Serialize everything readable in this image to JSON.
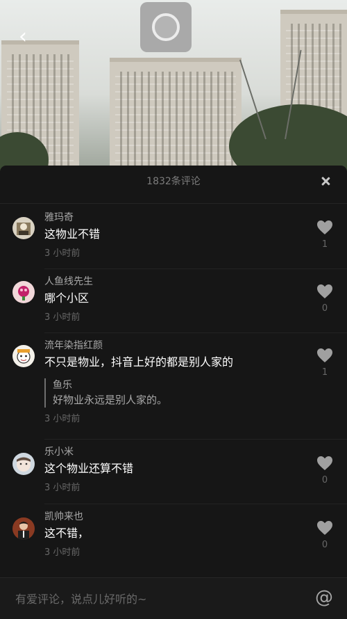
{
  "video": {
    "back_glyph": "‹",
    "record_icon": "record-circle-icon"
  },
  "panel": {
    "title": "1832条评论",
    "close_icon": "close-icon"
  },
  "comments": [
    {
      "user": "雅玛奇",
      "text": "这物业不错",
      "time": "3 小时前",
      "likes": "1"
    },
    {
      "user": "人鱼线先生",
      "text": "哪个小区",
      "time": "3 小时前",
      "likes": "0"
    },
    {
      "user": "流年染指红颜",
      "text": "不只是物业，抖音上好的都是别人家的",
      "reply": {
        "user": "鱼乐",
        "text": "好物业永远是别人家的。"
      },
      "time": "3 小时前",
      "likes": "1"
    },
    {
      "user": "乐小米",
      "text": "这个物业还算不错",
      "time": "3 小时前",
      "likes": "0"
    },
    {
      "user": "凯帅来也",
      "text": "这不错，",
      "time": "3 小时前",
      "likes": "0"
    }
  ],
  "input": {
    "placeholder": "有爱评论，说点儿好听的~",
    "at_glyph": "@"
  },
  "colors": {
    "panel_bg": "#161616",
    "text_primary": "#ffffff",
    "text_secondary": "#a9a9a9",
    "text_muted": "#686868",
    "heart": "#a0a0a0"
  }
}
